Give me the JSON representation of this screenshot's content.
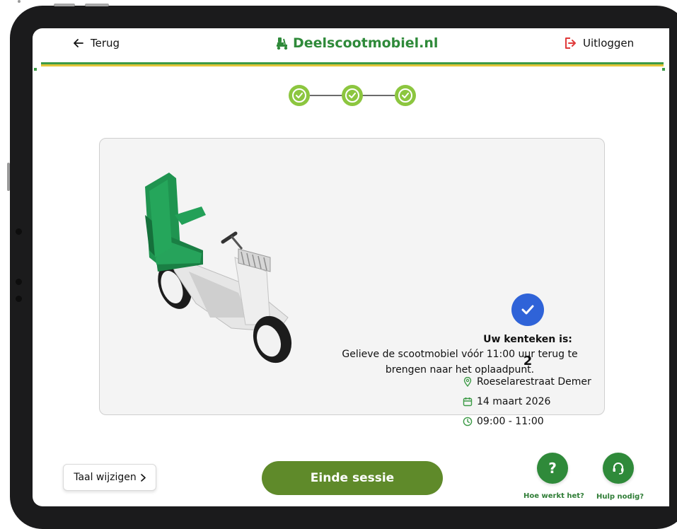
{
  "header": {
    "back_label": "Terug",
    "brand_name": "Deelscootmobiel.nl",
    "logout_label": "Uitloggen"
  },
  "stepper": {
    "steps": [
      {
        "state": "completed",
        "icon": "check-icon"
      },
      {
        "state": "completed",
        "icon": "check-icon"
      },
      {
        "state": "completed",
        "icon": "check-icon"
      }
    ]
  },
  "confirmation": {
    "plate_label": "Uw kenteken is:",
    "plate_value": "2",
    "location": "Roeselarestraat Demer",
    "date": "14 maart 2026",
    "time": "09:00 - 11:00",
    "notice": "Gelieve de scootmobiel vóór 11:00 uur terug te brengen naar het oplaadpunt."
  },
  "footer": {
    "language_button": "Taal wijzigen",
    "end_session_button": "Einde sessie",
    "how_it_works_label": "Hoe werkt het?",
    "help_label": "Hulp nodig?"
  },
  "colors": {
    "brand_green": "#2f8a3a",
    "step_green": "#8cc63f",
    "button_green": "#5f8a2a",
    "check_blue": "#2f63d8",
    "stripe_yellow": "#e4c53a"
  }
}
